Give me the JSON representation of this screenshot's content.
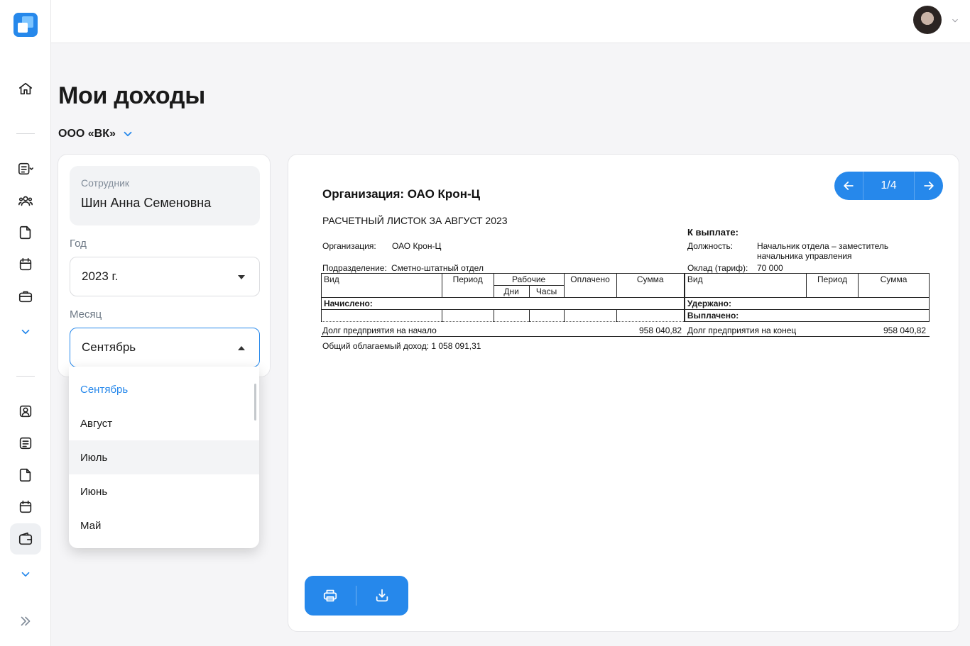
{
  "sidebar": {
    "icons": [
      "home-icon",
      "list-icon",
      "users-icon",
      "document-icon",
      "calendar-icon",
      "briefcase-icon",
      "chevron-down-icon",
      "profile-card-icon",
      "notes-icon",
      "document-icon",
      "calendar-icon",
      "wallet-icon",
      "chevron-down-icon",
      "expand-icon"
    ]
  },
  "page": {
    "title": "Мои доходы",
    "organization": "ООО «ВК»"
  },
  "filters": {
    "employee_label": "Сотрудник",
    "employee_value": "Шин Анна Семеновна",
    "year_label": "Год",
    "year_value": "2023 г.",
    "month_label": "Месяц",
    "month_value": "Сентябрь",
    "month_options": [
      "Сентябрь",
      "Август",
      "Июль",
      "Июнь",
      "Май"
    ]
  },
  "viewer": {
    "page_indicator": "1/4"
  },
  "payslip": {
    "title": "Организация: ОАО Крон-Ц",
    "heading": "РАСЧЕТНЫЙ ЛИСТОК ЗА АВГУСТ 2023",
    "to_pay_label": "К выплате:",
    "org_label": "Организация:",
    "org_value": "ОАО Крон-Ц",
    "position_label": "Должность:",
    "position_value_1": "Начальник отдела – заместитель",
    "position_value_2": "начальника управления",
    "dept_label": "Подразделение:",
    "dept_value": "Сметно-штатный отдел",
    "salary_label": "Оклад (тариф):",
    "salary_value": "70 000",
    "col_type": "Вид",
    "col_period": "Период",
    "col_working": "Рабочие",
    "col_days": "Дни",
    "col_hours": "Часы",
    "col_paid": "Оплачено",
    "col_sum": "Сумма",
    "accrued": "Начислено:",
    "withheld": "Удержано:",
    "paid_out": "Выплачено:",
    "debt_start_label": "Долг предприятия на начало",
    "debt_start_value": "958 040,82",
    "debt_end_label": "Долг предприятия на конец",
    "debt_end_value": "958 040,82",
    "taxable_income": "Общий облагаемый доход: 1 058 091,31"
  },
  "colors": {
    "accent": "#2688eb"
  }
}
